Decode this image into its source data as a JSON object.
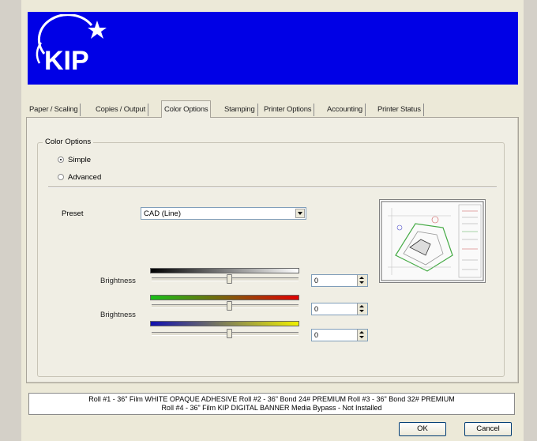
{
  "tabs": [
    "Paper / Scaling",
    "Copies / Output",
    "Color Options",
    "Stamping",
    "Printer Options",
    "Accounting",
    "Printer Status"
  ],
  "active_tab": "Color Options",
  "group": {
    "title": "Color Options",
    "radios": [
      {
        "label": "Simple",
        "checked": true
      },
      {
        "label": "Advanced",
        "checked": false
      }
    ]
  },
  "preset": {
    "label": "Preset",
    "value": "CAD (Line)"
  },
  "adjustments": [
    {
      "label": "Brightness",
      "value": "0"
    },
    {
      "label": "Brightness",
      "value": "0"
    },
    {
      "label": "",
      "value": "0"
    }
  ],
  "status": {
    "line1": "Roll #1 - 36\" Film WHITE OPAQUE ADHESIVE    Roll #2 - 36\" Bond 24# PREMIUM    Roll #3 - 36\" Bond 32# PREMIUM",
    "line2": "Roll #4 - 36\" Film KIP DIGITAL BANNER Media    Bypass - Not Installed"
  },
  "buttons": {
    "ok": "OK",
    "cancel": "Cancel"
  },
  "colors": {
    "banner": "#0000e6",
    "background": "#ece9d8"
  }
}
